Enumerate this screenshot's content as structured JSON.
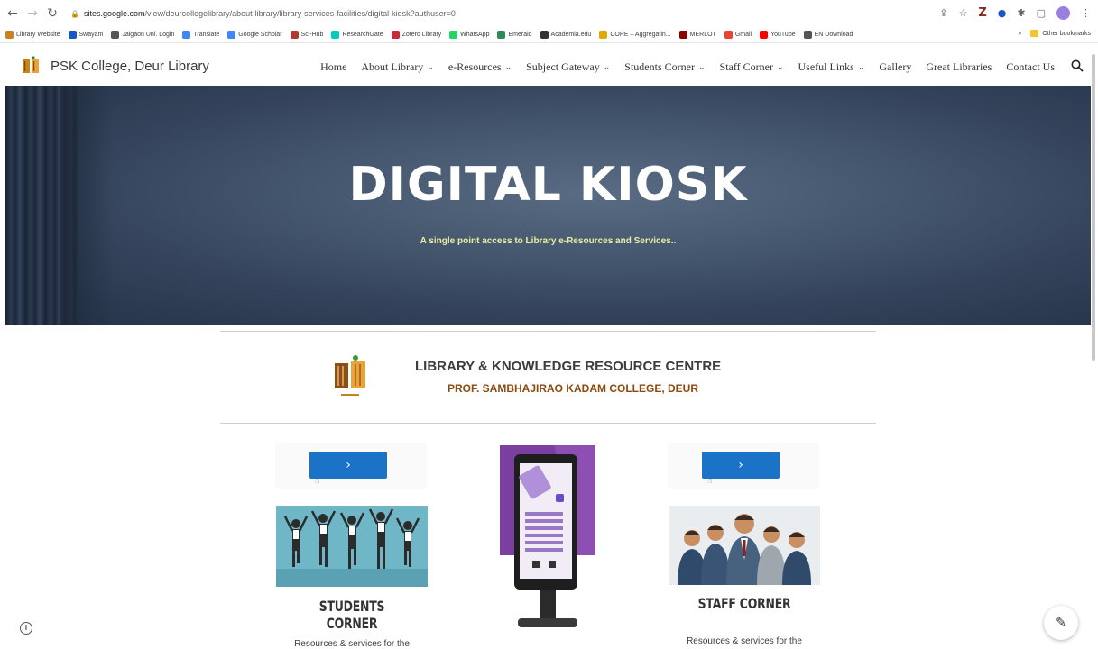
{
  "browser": {
    "url_host": "sites.google.com",
    "url_path": "/view/deurcollegelibrary/about-library/library-services-facilities/digital-kiosk?authuser=0",
    "bookmarks": [
      {
        "label": "Library Website",
        "icon": "library-icon",
        "color": "#c8821e"
      },
      {
        "label": "Swayam",
        "icon": "swayam-icon",
        "color": "#1a56c7"
      },
      {
        "label": "Jalgaon Uni. Login",
        "icon": "shield-icon",
        "color": "#555555"
      },
      {
        "label": "Translate",
        "icon": "translate-icon",
        "color": "#4285f4"
      },
      {
        "label": "Google Scholar",
        "icon": "scholar-icon",
        "color": "#4285f4"
      },
      {
        "label": "Sci-Hub",
        "icon": "scihub-icon",
        "color": "#b03a2e"
      },
      {
        "label": "ResearchGate",
        "icon": "researchgate-icon",
        "color": "#00ccbb"
      },
      {
        "label": "Zotero Library",
        "icon": "zotero-icon",
        "color": "#cc2936"
      },
      {
        "label": "WhatsApp",
        "icon": "whatsapp-icon",
        "color": "#25d366"
      },
      {
        "label": "Emerald",
        "icon": "emerald-icon",
        "color": "#2e8b57"
      },
      {
        "label": "Academia.edu",
        "icon": "academia-icon",
        "color": "#333333"
      },
      {
        "label": "CORE – Aggregatin...",
        "icon": "core-icon",
        "color": "#e0a800"
      },
      {
        "label": "MERLOT",
        "icon": "merlot-icon",
        "color": "#8b0000"
      },
      {
        "label": "Gmail",
        "icon": "gmail-icon",
        "color": "#ea4335"
      },
      {
        "label": "YouTube",
        "icon": "youtube-icon",
        "color": "#ff0000"
      },
      {
        "label": "EN Download",
        "icon": "download-icon",
        "color": "#555555"
      }
    ],
    "overflow_label": "»",
    "other_bookmarks": "Other bookmarks"
  },
  "site": {
    "title": "PSK College, Deur Library",
    "nav": [
      {
        "label": "Home",
        "dropdown": false
      },
      {
        "label": "About Library",
        "dropdown": true
      },
      {
        "label": "e-Resources",
        "dropdown": true
      },
      {
        "label": "Subject Gateway",
        "dropdown": true
      },
      {
        "label": "Students Corner",
        "dropdown": true
      },
      {
        "label": "Staff Corner",
        "dropdown": true
      },
      {
        "label": "Useful Links",
        "dropdown": true
      },
      {
        "label": "Gallery",
        "dropdown": false
      },
      {
        "label": "Great Libraries",
        "dropdown": false
      },
      {
        "label": "Contact Us",
        "dropdown": false
      }
    ]
  },
  "hero": {
    "title": "DIGITAL KIOSK",
    "subtitle": "A single point access to Library e-Resources and Services.."
  },
  "library": {
    "title": "LIBRARY & KNOWLEDGE RESOURCE CENTRE",
    "subtitle": "PROF. SAMBHAJIRAO KADAM COLLEGE, DEUR"
  },
  "cards": {
    "students": {
      "button_glyph": "›",
      "heading": "STUDENTS CORNER",
      "desc": "Resources & services for the"
    },
    "staff": {
      "button_glyph": "›",
      "heading": "STAFF CORNER",
      "desc": "Resources & services for the"
    }
  },
  "colors": {
    "button_blue": "#1a73c7",
    "library_subtitle": "#8a4a10",
    "hero_subtitle": "#e8f0a0"
  }
}
